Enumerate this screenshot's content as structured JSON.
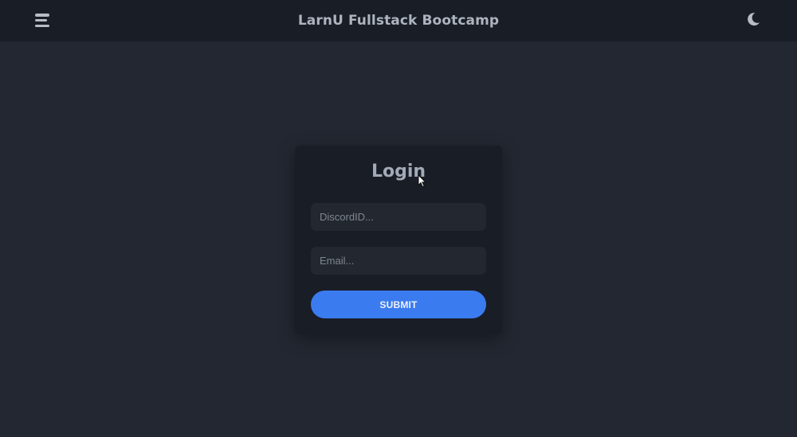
{
  "header": {
    "title": "LarnU Fullstack Bootcamp",
    "menu_icon": "hamburger-menu-icon",
    "theme_icon": "moon-icon"
  },
  "login": {
    "title": "Login",
    "discord_placeholder": "DiscordID...",
    "discord_value": "",
    "email_placeholder": "Email...",
    "email_value": "",
    "submit_label": "SUBMIT"
  },
  "colors": {
    "page_background": "#222731",
    "header_background": "#191d25",
    "card_background": "#191d25",
    "input_background": "#232830",
    "accent": "#3b7bf0",
    "text_muted": "#aeb4bf"
  }
}
